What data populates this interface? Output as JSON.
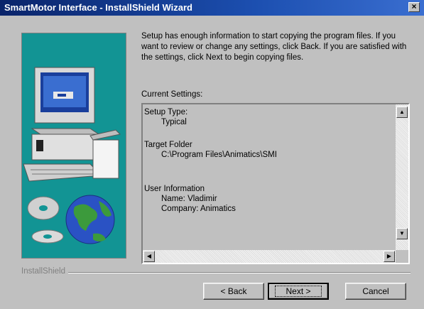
{
  "window": {
    "title": "SmartMotor Interface - InstallShield Wizard",
    "close_glyph": "×"
  },
  "message": "Setup has enough information to start copying the program files. If you want to review or change any settings, click Back.  If you are satisfied with the settings, click Next to begin copying files.",
  "settings": {
    "label": "Current Settings:",
    "setup_type_heading": "Setup Type:",
    "setup_type_value": "Typical",
    "target_folder_heading": "Target Folder",
    "target_folder_value": "C:\\Program Files\\Animatics\\SMI",
    "user_info_heading": "User Information",
    "user_name": "Name:  Vladimir",
    "user_company": "Company:  Animatics"
  },
  "footer": {
    "brand": "InstallShield"
  },
  "buttons": {
    "back": "< Back",
    "next": "Next >",
    "cancel": "Cancel"
  },
  "colors": {
    "title_bar": "#0a246a",
    "art_background": "#129494",
    "dialog_face": "#c0c0c0"
  },
  "icons": [
    "computer-icon",
    "cd-icon",
    "globe-icon",
    "close-icon",
    "scroll-up-icon",
    "scroll-down-icon",
    "scroll-left-icon",
    "scroll-right-icon"
  ]
}
